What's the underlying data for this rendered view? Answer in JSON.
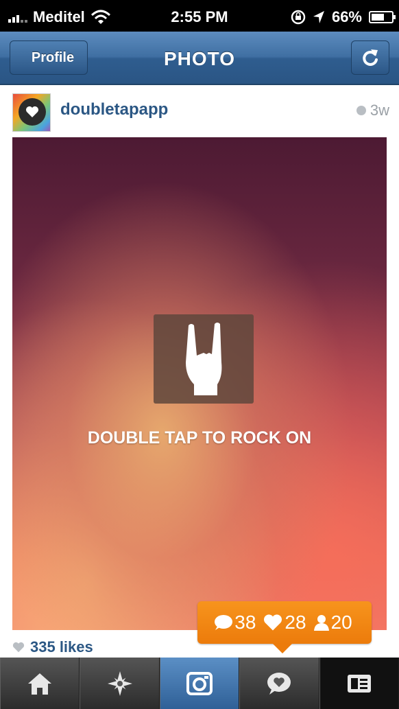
{
  "status_bar": {
    "carrier": "Meditel",
    "time": "2:55 PM",
    "battery_percent": "66%",
    "battery_level": 0.66
  },
  "nav": {
    "title": "PHOTO",
    "back_label": "Profile"
  },
  "post": {
    "username": "doubletapapp",
    "time_ago": "3w",
    "photo_caption": "DOUBLE TAP TO ROCK ON",
    "likes": "335 likes"
  },
  "activity": {
    "comments": "38",
    "likes": "28",
    "followers": "20"
  },
  "colors": {
    "nav_blue": "#3f6fa2",
    "link_blue": "#2b5784",
    "bubble_orange": "#f7941d"
  },
  "tabs": [
    {
      "icon": "home-icon"
    },
    {
      "icon": "explore-icon"
    },
    {
      "icon": "camera-icon",
      "active": true
    },
    {
      "icon": "news-icon"
    },
    {
      "icon": "profile-icon"
    }
  ]
}
